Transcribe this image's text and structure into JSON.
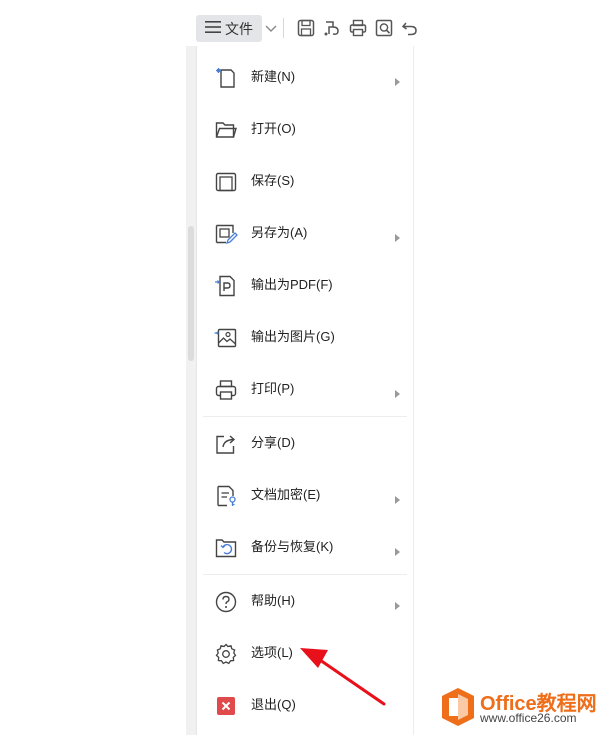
{
  "toolbar": {
    "file_label": "文件",
    "icons": [
      "menu-icon",
      "chevron-down-icon",
      "save-icon",
      "save-as-cloud-icon",
      "print-icon",
      "print-preview-icon",
      "undo-icon"
    ]
  },
  "menu": {
    "items": [
      {
        "label": "新建(N)",
        "icon": "new-file-icon",
        "submenu": true
      },
      {
        "label": "打开(O)",
        "icon": "folder-open-icon",
        "submenu": false
      },
      {
        "label": "保存(S)",
        "icon": "save-icon",
        "submenu": false
      },
      {
        "label": "另存为(A)",
        "icon": "save-as-icon",
        "submenu": true
      },
      {
        "label": "输出为PDF(F)",
        "icon": "export-pdf-icon",
        "submenu": false
      },
      {
        "label": "输出为图片(G)",
        "icon": "export-image-icon",
        "submenu": false
      },
      {
        "label": "打印(P)",
        "icon": "print-icon",
        "submenu": true
      },
      {
        "label": "分享(D)",
        "icon": "share-icon",
        "submenu": false
      },
      {
        "label": "文档加密(E)",
        "icon": "document-encrypt-icon",
        "submenu": true
      },
      {
        "label": "备份与恢复(K)",
        "icon": "backup-restore-icon",
        "submenu": true
      },
      {
        "label": "帮助(H)",
        "icon": "help-icon",
        "submenu": true
      },
      {
        "label": "选项(L)",
        "icon": "gear-icon",
        "submenu": false
      },
      {
        "label": "退出(Q)",
        "icon": "exit-icon",
        "submenu": false
      }
    ]
  },
  "watermark": {
    "brand": "Office教程网",
    "url": "www.office26.com"
  },
  "colors": {
    "accent": "#4a7fd8",
    "exit_red": "#e04a4a",
    "annotation_red": "#e8101a",
    "watermark_orange": "#ee6e1a"
  }
}
